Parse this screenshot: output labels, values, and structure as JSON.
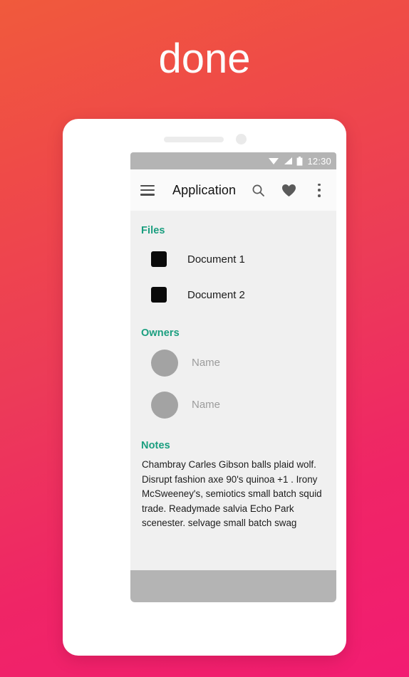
{
  "headline": "done",
  "phone": {
    "speaker": "speaker-grille",
    "camera": "front-camera"
  },
  "status_bar": {
    "wifi_icon": "wifi-icon",
    "signal_icon": "cellular-signal-icon",
    "battery_icon": "battery-icon",
    "time": "12:30"
  },
  "app_bar": {
    "menu_icon": "hamburger-menu-icon",
    "title": "Application",
    "search_icon": "search-icon",
    "favorite_icon": "heart-icon",
    "overflow_icon": "more-vertical-icon"
  },
  "sections": {
    "files": {
      "header": "Files",
      "items": [
        {
          "label": "Document 1",
          "thumb": "document-thumbnail"
        },
        {
          "label": "Document 2",
          "thumb": "document-thumbnail"
        }
      ]
    },
    "owners": {
      "header": "Owners",
      "items": [
        {
          "name": "Name",
          "avatar": "avatar-placeholder"
        },
        {
          "name": "Name",
          "avatar": "avatar-placeholder"
        }
      ]
    },
    "notes": {
      "header": "Notes",
      "body": "Chambray Carles Gibson balls plaid wolf. Disrupt fashion axe 90's quinoa +1 . Irony McSweeney's, semiotics small batch squid trade. Readymade salvia Echo Park scenester. selvage small batch swag"
    }
  },
  "colors": {
    "accent_teal": "#1a9e7f",
    "gradient_start": "#f05a3c",
    "gradient_end": "#f21c72",
    "status_bar": "#b4b4b4",
    "nav_bar": "#b4b4b4",
    "content_bg": "#f0f0f0",
    "app_bar_bg": "#fafafa"
  }
}
